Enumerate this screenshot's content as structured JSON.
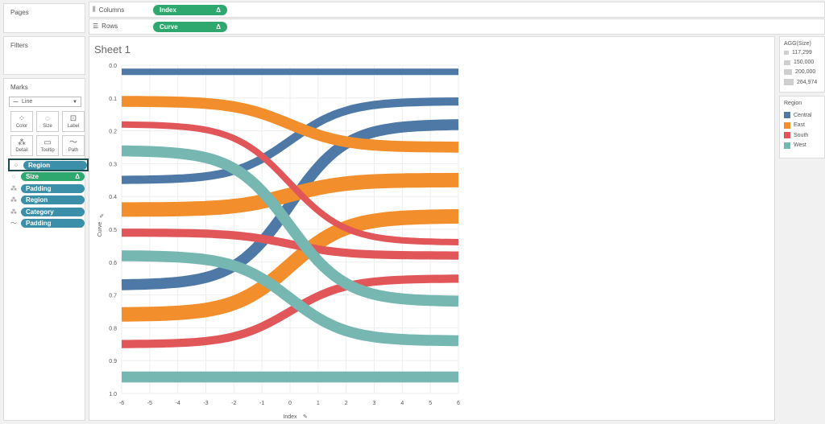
{
  "panels": {
    "pages": "Pages",
    "filters": "Filters",
    "marks": "Marks"
  },
  "shelves": {
    "columns": {
      "label": "Columns",
      "pill": "Index",
      "delta": "Δ",
      "icon": "columns-icon"
    },
    "rows": {
      "label": "Rows",
      "pill": "Curve",
      "delta": "Δ",
      "icon": "rows-icon"
    }
  },
  "marks": {
    "type": "Line",
    "buttons": [
      {
        "label": "Color",
        "icon": "color-icon",
        "glyph": "⁘"
      },
      {
        "label": "Size",
        "icon": "size-icon",
        "glyph": "◌"
      },
      {
        "label": "Label",
        "icon": "label-icon",
        "glyph": "⊡"
      },
      {
        "label": "Detail",
        "icon": "detail-icon",
        "glyph": "⁂"
      },
      {
        "label": "Tooltip",
        "icon": "tooltip-icon",
        "glyph": "▭"
      },
      {
        "label": "Path",
        "icon": "path-icon",
        "glyph": "〜"
      }
    ],
    "fields": [
      {
        "name": "Region",
        "role": "color",
        "glyph": "⁘",
        "color": "blue"
      },
      {
        "name": "Size",
        "role": "size",
        "glyph": "◌",
        "color": "green",
        "delta": "Δ"
      },
      {
        "name": "Padding",
        "role": "detail",
        "glyph": "⁂",
        "color": "blue"
      },
      {
        "name": "Region",
        "role": "detail",
        "glyph": "⁂",
        "color": "blue"
      },
      {
        "name": "Category",
        "role": "detail",
        "glyph": "⁂",
        "color": "blue"
      },
      {
        "name": "Padding",
        "role": "path",
        "glyph": "〜",
        "color": "blue"
      }
    ]
  },
  "sheet": {
    "title": "Sheet 1"
  },
  "legends": {
    "size": {
      "title": "AGG(Size)",
      "items": [
        "117,299",
        "150,000",
        "200,000",
        "264,974"
      ]
    },
    "color": {
      "title": "Region",
      "items": [
        {
          "name": "Central",
          "color": "#4e79a7"
        },
        {
          "name": "East",
          "color": "#f28e2b"
        },
        {
          "name": "South",
          "color": "#e15759"
        },
        {
          "name": "West",
          "color": "#76b7b2"
        }
      ]
    }
  },
  "chart_data": {
    "type": "line",
    "xlabel": "Index",
    "ylabel": "Curve",
    "xlim": [
      -6,
      6
    ],
    "ylim": [
      0.0,
      1.0
    ],
    "y_reversed": true,
    "x_ticks": [
      "-6",
      "-5",
      "-4",
      "-3",
      "-2",
      "-1",
      "0",
      "1",
      "2",
      "3",
      "4",
      "5",
      "6"
    ],
    "y_ticks": [
      "0.0",
      "0.1",
      "0.2",
      "0.3",
      "0.4",
      "0.5",
      "0.6",
      "0.7",
      "0.8",
      "0.9",
      "1.0"
    ],
    "series": [
      {
        "name": "Central",
        "color": "#4e79a7",
        "start": 0.02,
        "end": 0.02,
        "size": 117299
      },
      {
        "name": "Central",
        "color": "#4e79a7",
        "start": 0.35,
        "end": 0.11,
        "size": 150000
      },
      {
        "name": "Central",
        "color": "#4e79a7",
        "start": 0.67,
        "end": 0.18,
        "size": 200000
      },
      {
        "name": "East",
        "color": "#f28e2b",
        "start": 0.11,
        "end": 0.25,
        "size": 200000
      },
      {
        "name": "East",
        "color": "#f28e2b",
        "start": 0.44,
        "end": 0.35,
        "size": 264974
      },
      {
        "name": "East",
        "color": "#f28e2b",
        "start": 0.76,
        "end": 0.46,
        "size": 264974
      },
      {
        "name": "South",
        "color": "#e15759",
        "start": 0.18,
        "end": 0.54,
        "size": 117299
      },
      {
        "name": "South",
        "color": "#e15759",
        "start": 0.51,
        "end": 0.58,
        "size": 150000
      },
      {
        "name": "South",
        "color": "#e15759",
        "start": 0.85,
        "end": 0.65,
        "size": 150000
      },
      {
        "name": "West",
        "color": "#76b7b2",
        "start": 0.26,
        "end": 0.72,
        "size": 200000
      },
      {
        "name": "West",
        "color": "#76b7b2",
        "start": 0.58,
        "end": 0.84,
        "size": 200000
      },
      {
        "name": "West",
        "color": "#76b7b2",
        "start": 0.95,
        "end": 0.95,
        "size": 200000
      }
    ]
  }
}
